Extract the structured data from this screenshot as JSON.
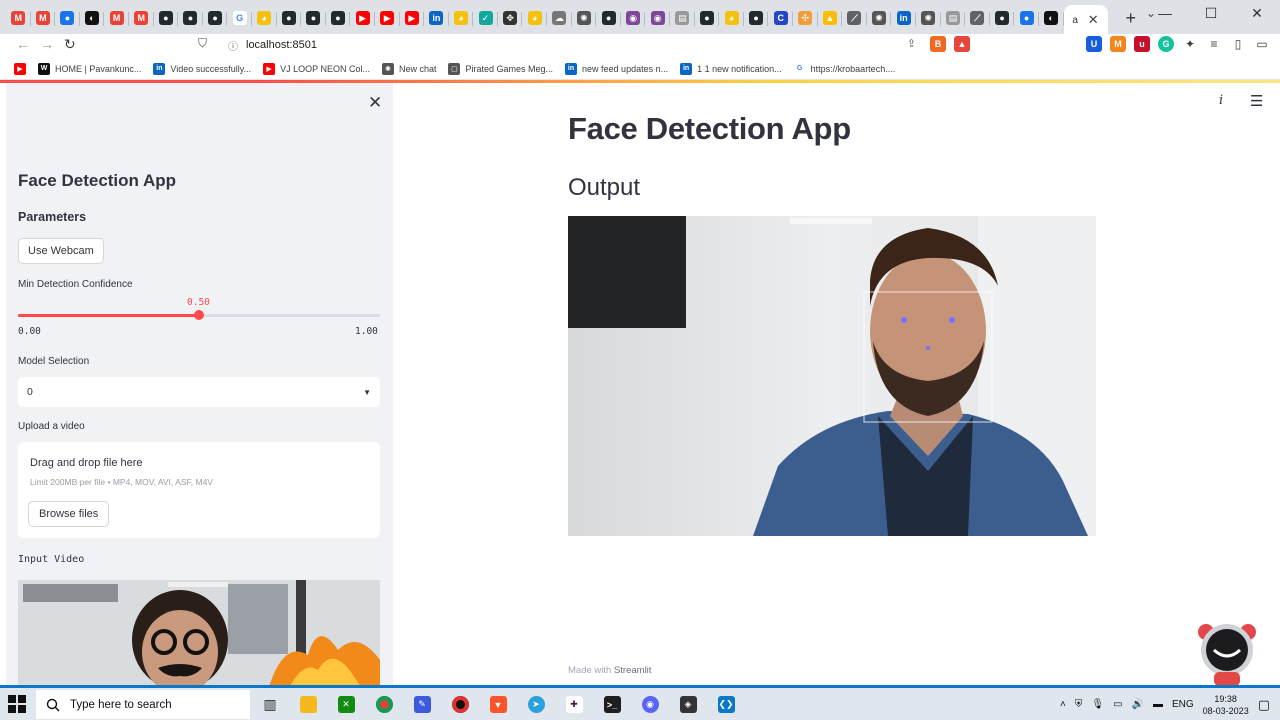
{
  "browser": {
    "active_tab_label": "a",
    "url": "localhost:8501",
    "window_controls": [
      "minimize-icon",
      "maximize-icon",
      "close-icon"
    ],
    "tab_favicons": [
      "gmail-icon",
      "gmail-icon",
      "chrome-icon",
      "app-icon",
      "gmail-icon",
      "gmail-icon",
      "github-icon",
      "github-icon",
      "github-icon",
      "google-icon",
      "bard-icon",
      "github-icon",
      "github-icon",
      "github-icon",
      "youtube-icon",
      "youtube-icon",
      "youtube-icon",
      "linkedin-icon",
      "bard-icon",
      "check-icon",
      "move-icon",
      "bard-icon",
      "cloud-icon",
      "openai-icon",
      "github-icon",
      "tor-icon",
      "tor-icon",
      "doc-icon",
      "github-icon",
      "bard-icon",
      "github-icon",
      "c-icon",
      "puzzle-icon",
      "drive-icon",
      "link-icon",
      "openai-icon",
      "linkedin-icon",
      "openai-icon",
      "doc-icon",
      "link-icon",
      "github-icon",
      "chrome-icon",
      "app-icon"
    ],
    "bookmarks": [
      {
        "icon": "youtube-icon",
        "label": ""
      },
      {
        "icon": "wix-icon",
        "label": "HOME | Pavankunc..."
      },
      {
        "icon": "linkedin-icon",
        "label": "Video successfully..."
      },
      {
        "icon": "youtube-icon",
        "label": "VJ LOOP NEON Col..."
      },
      {
        "icon": "openai-icon",
        "label": "New chat"
      },
      {
        "icon": "bookmark-icon",
        "label": "Pirated Games Meg..."
      },
      {
        "icon": "linkedin-icon",
        "label": "new feed updates n..."
      },
      {
        "icon": "linkedin-icon",
        "label": "1 1 new notification..."
      },
      {
        "icon": "google-icon",
        "label": "https://krobaartech...."
      }
    ]
  },
  "sidebar": {
    "title": "Face Detection App",
    "subheader": "Parameters",
    "webcam_button": "Use Webcam",
    "slider": {
      "label": "Min Detection Confidence",
      "value_text": "0.50",
      "value": 0.5,
      "min": 0.0,
      "max": 1.0,
      "min_text": "0.00",
      "max_text": "1.00"
    },
    "select": {
      "label": "Model Selection",
      "value": "0"
    },
    "uploader": {
      "label": "Upload a video",
      "title": "Drag and drop file here",
      "limit": "Limit 200MB per file • MP4, MOV, AVI, ASF, M4V",
      "browse_button": "Browse files"
    },
    "input_video_label": "Input Video"
  },
  "main": {
    "title": "Face Detection App",
    "output_heading": "Output",
    "footer_prefix": "Made with",
    "footer_brand": "Streamlit"
  },
  "taskbar": {
    "search_placeholder": "Type here to search",
    "language": "ENG",
    "time": "19:38",
    "date": "08-03-2023"
  },
  "colors": {
    "accent": "#ff4b4b",
    "sidebar_bg": "#f0f2f6",
    "text": "#31333f"
  }
}
